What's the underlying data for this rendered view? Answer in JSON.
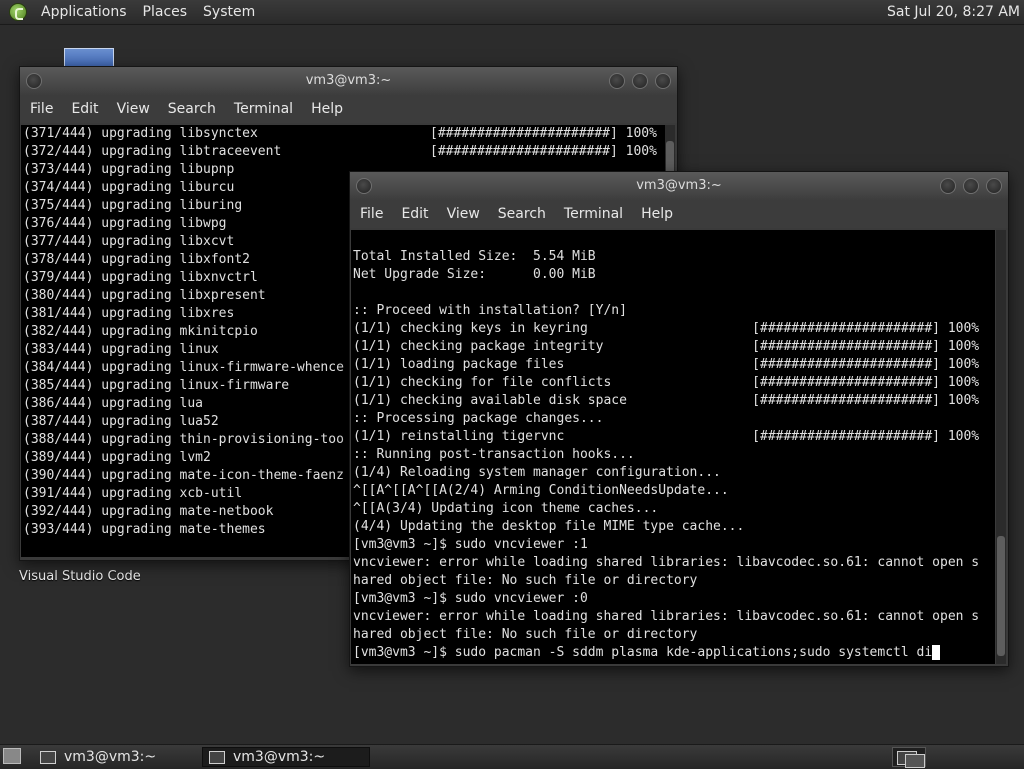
{
  "top_panel": {
    "menus": [
      "Applications",
      "Places",
      "System"
    ],
    "clock": "Sat Jul 20,  8:27 AM"
  },
  "desktop": {
    "icon_label": "Visual Studio Code"
  },
  "window_back": {
    "title": "vm3@vm3:~",
    "menu": [
      "File",
      "Edit",
      "View",
      "Search",
      "Terminal",
      "Help"
    ],
    "lines": [
      "(371/444) upgrading libsynctex                      [######################] 100%",
      "(372/444) upgrading libtraceevent                   [######################] 100%",
      "(373/444) upgrading libupnp",
      "(374/444) upgrading liburcu",
      "(375/444) upgrading liburing",
      "(376/444) upgrading libwpg",
      "(377/444) upgrading libxcvt",
      "(378/444) upgrading libxfont2",
      "(379/444) upgrading libxnvctrl",
      "(380/444) upgrading libxpresent",
      "(381/444) upgrading libxres",
      "(382/444) upgrading mkinitcpio",
      "(383/444) upgrading linux",
      "(384/444) upgrading linux-firmware-whence",
      "(385/444) upgrading linux-firmware",
      "(386/444) upgrading lua",
      "(387/444) upgrading lua52",
      "(388/444) upgrading thin-provisioning-too",
      "(389/444) upgrading lvm2",
      "(390/444) upgrading mate-icon-theme-faenz",
      "(391/444) upgrading xcb-util",
      "(392/444) upgrading mate-netbook",
      "(393/444) upgrading mate-themes"
    ]
  },
  "window_front": {
    "title": "vm3@vm3:~",
    "menu": [
      "File",
      "Edit",
      "View",
      "Search",
      "Terminal",
      "Help"
    ],
    "lines": [
      "",
      "Total Installed Size:  5.54 MiB",
      "Net Upgrade Size:      0.00 MiB",
      "",
      ":: Proceed with installation? [Y/n]",
      "(1/1) checking keys in keyring                     [######################] 100%",
      "(1/1) checking package integrity                   [######################] 100%",
      "(1/1) loading package files                        [######################] 100%",
      "(1/1) checking for file conflicts                  [######################] 100%",
      "(1/1) checking available disk space                [######################] 100%",
      ":: Processing package changes...",
      "(1/1) reinstalling tigervnc                        [######################] 100%",
      ":: Running post-transaction hooks...",
      "(1/4) Reloading system manager configuration...",
      "^[[A^[[A^[[A(2/4) Arming ConditionNeedsUpdate...",
      "^[[A(3/4) Updating icon theme caches...",
      "(4/4) Updating the desktop file MIME type cache...",
      "[vm3@vm3 ~]$ sudo vncviewer :1",
      "vncviewer: error while loading shared libraries: libavcodec.so.61: cannot open s",
      "hared object file: No such file or directory",
      "[vm3@vm3 ~]$ sudo vncviewer :0",
      "vncviewer: error while loading shared libraries: libavcodec.so.61: cannot open s",
      "hared object file: No such file or directory"
    ],
    "prompt_line": "[vm3@vm3 ~]$ sudo pacman -S sddm plasma kde-applications;sudo systemctl di"
  },
  "taskbar": {
    "tasks": [
      "vm3@vm3:~",
      "vm3@vm3:~"
    ]
  }
}
